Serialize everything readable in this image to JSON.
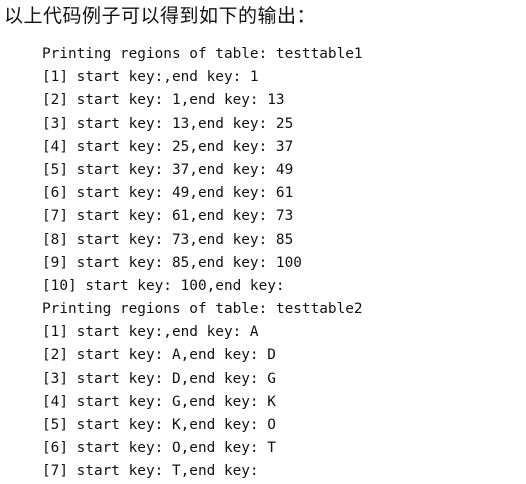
{
  "intro": "以上代码例子可以得到如下的输出：",
  "lines": [
    "Printing regions of table: testtable1",
    "[1] start key:,end key: 1",
    "[2] start key: 1,end key: 13",
    "[3] start key: 13,end key: 25",
    "[4] start key: 25,end key: 37",
    "[5] start key: 37,end key: 49",
    "[6] start key: 49,end key: 61",
    "[7] start key: 61,end key: 73",
    "[8] start key: 73,end key: 85",
    "[9] start key: 85,end key: 100",
    "[10] start key: 100,end key:",
    "Printing regions of table: testtable2",
    "[1] start key:,end key: A",
    "[2] start key: A,end key: D",
    "[3] start key: D,end key: G",
    "[4] start key: G,end key: K",
    "[5] start key: K,end key: O",
    "[6] start key: O,end key: T",
    "[7] start key: T,end key:"
  ]
}
